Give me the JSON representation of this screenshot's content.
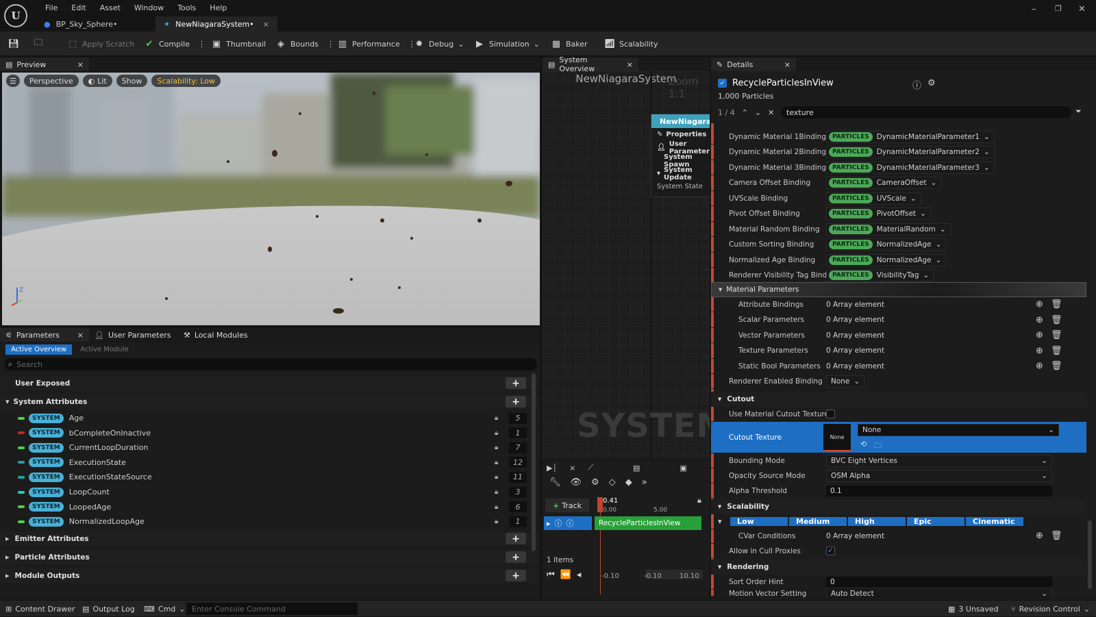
{
  "menu": [
    "File",
    "Edit",
    "Asset",
    "Window",
    "Tools",
    "Help"
  ],
  "doc_tabs": [
    {
      "label": "BP_Sky_Sphere•"
    },
    {
      "label": "NewNiagaraSystem•"
    }
  ],
  "toolbar": {
    "apply_scratch": "Apply Scratch",
    "compile": "Compile",
    "thumbnail": "Thumbnail",
    "bounds": "Bounds",
    "performance": "Performance",
    "debug": "Debug",
    "simulation": "Simulation",
    "baker": "Baker",
    "scalability": "Scalability"
  },
  "preview": {
    "tab": "Preview",
    "perspective": "Perspective",
    "lit": "Lit",
    "show": "Show",
    "scalability": "Scalability: Low"
  },
  "params": {
    "tabs": [
      "Parameters",
      "User Parameters",
      "Local Modules"
    ],
    "subtabs": [
      "Active Overview",
      "Active Module"
    ],
    "search_placeholder": "Search",
    "user_exposed": "User Exposed",
    "system_attributes": "System Attributes",
    "badge": "SYSTEM",
    "attributes": [
      {
        "name": "Age",
        "count": "5",
        "color": "#4cd14a"
      },
      {
        "name": "bCompleteOnInactive",
        "count": "1",
        "color": "#c12626"
      },
      {
        "name": "CurrentLoopDuration",
        "count": "7",
        "color": "#4cd14a"
      },
      {
        "name": "ExecutionState",
        "count": "12",
        "color": "#1fa39a"
      },
      {
        "name": "ExecutionStateSource",
        "count": "11",
        "color": "#1fa39a"
      },
      {
        "name": "LoopCount",
        "count": "3",
        "color": "#2bc9b8"
      },
      {
        "name": "LoopedAge",
        "count": "6",
        "color": "#4cd14a"
      },
      {
        "name": "NormalizedLoopAge",
        "count": "1",
        "color": "#4cd14a"
      }
    ],
    "collapsed": [
      "Emitter Attributes",
      "Particle Attributes",
      "Module Outputs"
    ]
  },
  "system_overview": {
    "tab": "System Overview",
    "title": "NewNiagaraSystem",
    "zoom": "Zoom 1:1",
    "node_title": "NewNiagaraSy",
    "node_items": [
      "Properties",
      "User Parameters",
      "System Spawn",
      "System Update",
      "System State"
    ],
    "watermark": "SYSTEM"
  },
  "timeline": {
    "track_btn": "Track",
    "time": "0.41",
    "tick0": "0.00",
    "tick1": "5.00",
    "emitter": "RecycleParticlesInView",
    "items": "1 items",
    "range_start": "-0.10",
    "range_mid": "-0.10",
    "range_end": "10.10"
  },
  "details": {
    "tab": "Details",
    "title": "RecycleParticlesInView",
    "particles": "1,000 Particles",
    "search_index": "1 / 4",
    "search_value": "texture",
    "particles_badge": "PARTICLES",
    "bindings": [
      {
        "label": "Dynamic Material 1Binding",
        "value": "DynamicMaterialParameter1"
      },
      {
        "label": "Dynamic Material 2Binding",
        "value": "DynamicMaterialParameter2"
      },
      {
        "label": "Dynamic Material 3Binding",
        "value": "DynamicMaterialParameter3"
      },
      {
        "label": "Camera Offset Binding",
        "value": "CameraOffset"
      },
      {
        "label": "UVScale Binding",
        "value": "UVScale"
      },
      {
        "label": "Pivot Offset Binding",
        "value": "PivotOffset"
      },
      {
        "label": "Material Random Binding",
        "value": "MaterialRandom"
      },
      {
        "label": "Custom Sorting Binding",
        "value": "NormalizedAge"
      },
      {
        "label": "Normalized Age Binding",
        "value": "NormalizedAge"
      },
      {
        "label": "Renderer Visibility Tag Binding",
        "value": "VisibilityTag"
      }
    ],
    "material_parameters": "Material Parameters",
    "mat_rows": [
      {
        "label": "Attribute Bindings",
        "value": "0 Array element"
      },
      {
        "label": "Scalar Parameters",
        "value": "0 Array element"
      },
      {
        "label": "Vector Parameters",
        "value": "0 Array element"
      },
      {
        "label": "Texture Parameters",
        "value": "0 Array element"
      },
      {
        "label": "Static Bool Parameters",
        "value": "0 Array element"
      }
    ],
    "renderer_enabled_label": "Renderer Enabled Binding",
    "renderer_enabled_value": "None",
    "cutout": "Cutout",
    "use_cutout_label": "Use Material Cutout Texture",
    "cutout_texture_label": "Cutout Texture",
    "cutout_thumb": "None",
    "cutout_value": "None",
    "bounding_label": "Bounding Mode",
    "bounding_value": "BVC Eight Vertices",
    "opacity_label": "Opacity Source Mode",
    "opacity_value": "OSM Alpha",
    "alpha_label": "Alpha Threshold",
    "alpha_value": "0.1",
    "scalability": "Scalability",
    "scal_levels": [
      "Low",
      "Medium",
      "High",
      "Epic",
      "Cinematic"
    ],
    "cvar_label": "CVar Conditions",
    "cvar_value": "0 Array element",
    "cull_label": "Allow in Cull Proxies",
    "rendering": "Rendering",
    "sort_label": "Sort Order Hint",
    "sort_value": "0",
    "motion_label": "Motion Vector Setting",
    "motion_value": "Auto Detect"
  },
  "status": {
    "content_drawer": "Content Drawer",
    "output_log": "Output Log",
    "cmd": "Cmd",
    "console_placeholder": "Enter Console Command",
    "unsaved": "3 Unsaved",
    "revision": "Revision Control"
  }
}
